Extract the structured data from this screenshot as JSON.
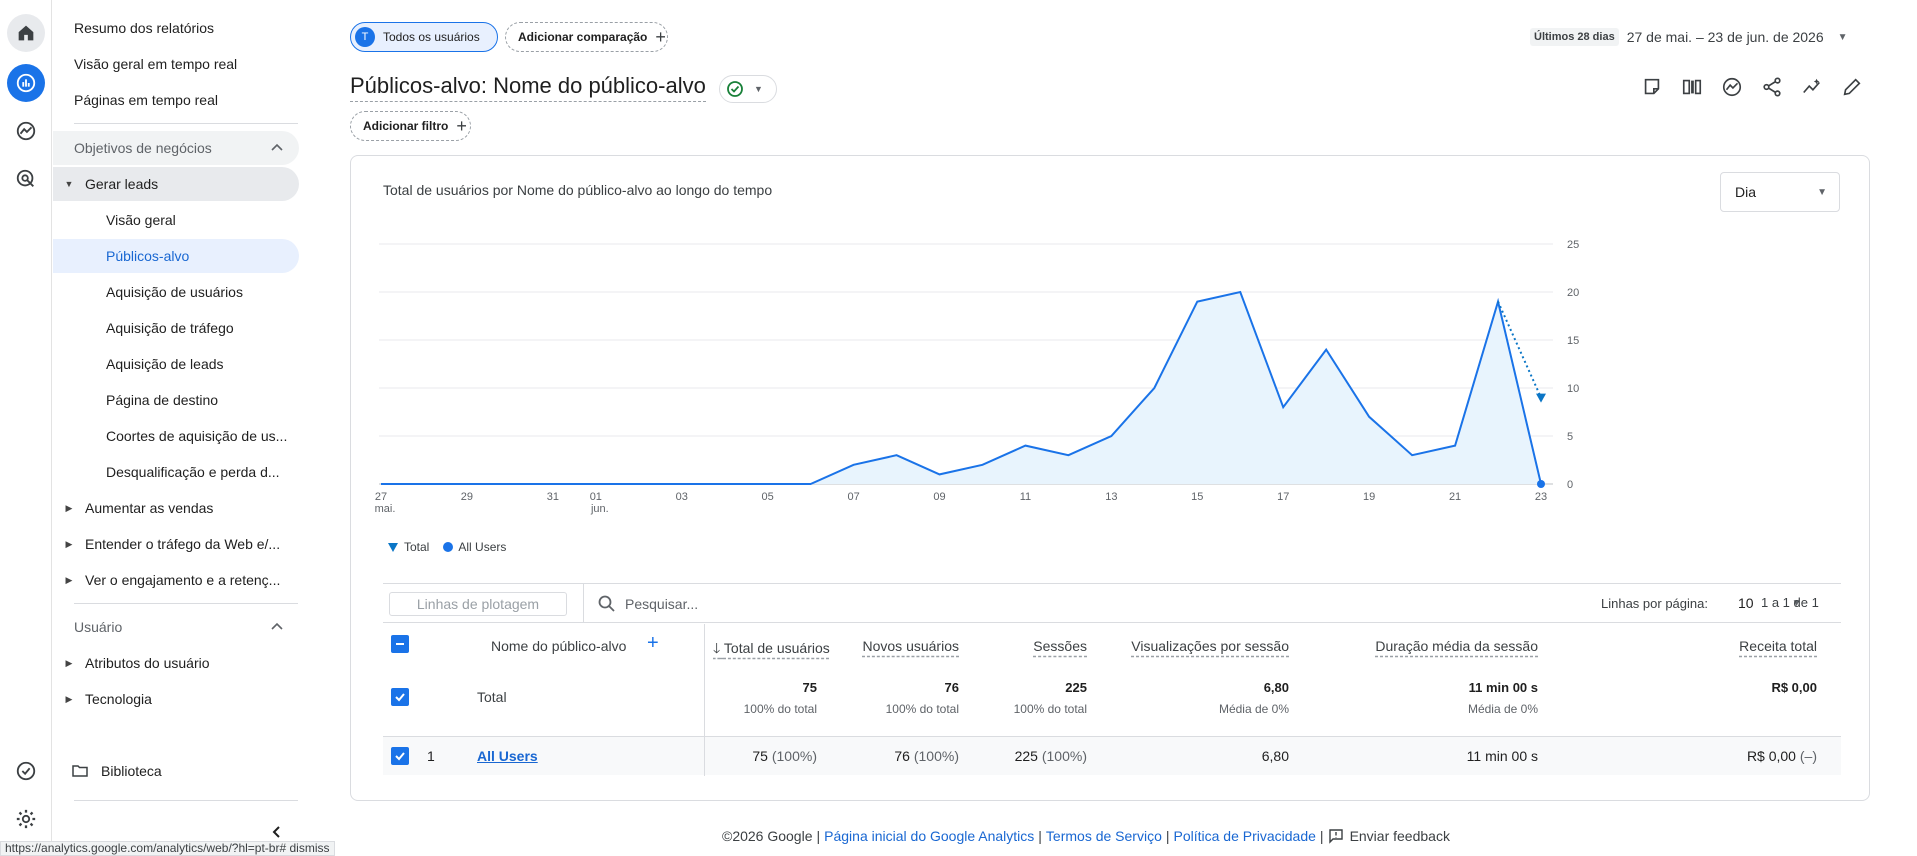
{
  "nav": {
    "top_items": [
      "Resumo dos relatórios",
      "Visão geral em tempo real",
      "Páginas em tempo real"
    ],
    "section_business": "Objetivos de negócios",
    "group_leads": "Gerar leads",
    "leads_items": [
      "Visão geral",
      "Públicos-alvo",
      "Aquisição de usuários",
      "Aquisição de tráfego",
      "Aquisição de leads",
      "Página de destino",
      "Coortes de aquisição de us...",
      "Desqualificação e perda d..."
    ],
    "other_groups": [
      "Aumentar as vendas",
      "Entender o tráfego da Web e/...",
      "Ver o engajamento e a retenç..."
    ],
    "section_user": "Usuário",
    "user_groups": [
      "Atributos do usuário",
      "Tecnologia"
    ],
    "library": "Biblioteca"
  },
  "header": {
    "chip_users_avatar": "T",
    "chip_users": "Todos os usuários",
    "chip_compare": "Adicionar comparação",
    "chip_plus": "+",
    "date_last": "Últimos 28 dias",
    "date_range": "27 de mai. – 23 de jun. de 2026",
    "title": "Públicos-alvo: Nome do público-alvo",
    "filter": "Adicionar filtro"
  },
  "card": {
    "title": "Total de usuários por Nome do público-alvo ao longo do tempo",
    "granularity": "Dia"
  },
  "chart_data": {
    "type": "area",
    "x": [
      "27 mai.",
      "28",
      "29",
      "30",
      "31",
      "01 jun.",
      "02",
      "03",
      "04",
      "05",
      "06",
      "07",
      "08",
      "09",
      "10",
      "11",
      "12",
      "13",
      "14",
      "15",
      "16",
      "17",
      "18",
      "19",
      "20",
      "21",
      "22",
      "23"
    ],
    "x_tick_labels": [
      "27",
      "29",
      "31",
      "01",
      "03",
      "05",
      "07",
      "09",
      "11",
      "13",
      "15",
      "17",
      "19",
      "21",
      "23"
    ],
    "x_tick_sublabels": {
      "27": "mai.",
      "01": "jun."
    },
    "series": [
      {
        "name": "All Users",
        "values": [
          0,
          0,
          0,
          0,
          0,
          0,
          0,
          0,
          0,
          0,
          0,
          2,
          3,
          1,
          2,
          4,
          3,
          5,
          10,
          19,
          20,
          8,
          14,
          7,
          3,
          4,
          19,
          0
        ]
      },
      {
        "name": "Total",
        "values": [
          0,
          0,
          0,
          0,
          0,
          0,
          0,
          0,
          0,
          0,
          0,
          2,
          3,
          1,
          2,
          4,
          3,
          5,
          10,
          19,
          20,
          8,
          14,
          7,
          3,
          4,
          19,
          9
        ]
      }
    ],
    "ylim": [
      0,
      25
    ],
    "y_ticks": [
      0,
      5,
      10,
      15,
      20,
      25
    ],
    "legend": [
      "Total",
      "All Users"
    ],
    "legend_position": "bottom-left",
    "grid": true
  },
  "table_controls": {
    "plot_rows": "Linhas de plotagem",
    "search_placeholder": "Pesquisar...",
    "rows_per_page_label": "Linhas por página:",
    "rows_per_page": "10",
    "pager": "1 a 1 de 1"
  },
  "table": {
    "columns": [
      "Nome do público-alvo",
      "Total de usuários",
      "Novos usuários",
      "Sessões",
      "Visualizações por sessão",
      "Duração média da sessão",
      "Receita total"
    ],
    "add_column": "+",
    "total": {
      "label": "Total",
      "values": [
        "75",
        "76",
        "225",
        "6,80",
        "11 min 00 s",
        "R$ 0,00"
      ],
      "subs": [
        "100% do total",
        "100% do total",
        "100% do total",
        "Média de 0%",
        "Média de 0%",
        ""
      ]
    },
    "rows": [
      {
        "index": "1",
        "name": "All Users",
        "values": [
          "75",
          "76",
          "225",
          "6,80",
          "11 min 00 s",
          "R$ 0,00"
        ],
        "pcts": [
          "(100%)",
          "(100%)",
          "(100%)",
          "",
          "",
          "(–)"
        ]
      }
    ]
  },
  "footer": {
    "copyright": "©2026 Google",
    "links": [
      "Página inicial do Google Analytics",
      "Termos de Serviço",
      "Política de Privacidade"
    ],
    "feedback": "Enviar feedback"
  },
  "status_url": "https://analytics.google.com/analytics/web/?hl=pt-br#  dismiss",
  "colors": {
    "accent": "#1a73e8",
    "active_bg": "#e8f0fe",
    "series_line": "#1a73e8",
    "series_fill": "#e8f4fd"
  }
}
